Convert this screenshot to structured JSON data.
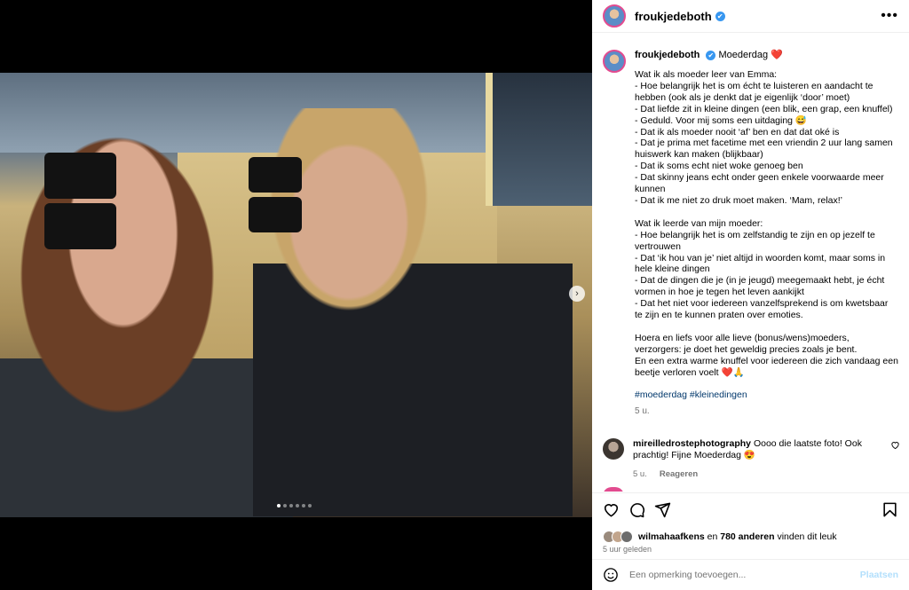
{
  "post": {
    "username": "froukjedeboth",
    "verified_mark": "✔",
    "more_icon": "more-horizontal-icon",
    "caption_title": "Moederdag",
    "caption_heart": "❤️",
    "caption": "Wat ik als moeder leer van Emma:\n- Hoe belangrijk het is om écht te luisteren en aandacht te hebben (ook als je denkt dat je eigenlijk ‘door’ moet)\n- Dat liefde zit in kleine dingen (een blik, een grap, een knuffel)\n- Geduld. Voor mij soms een uitdaging 😅\n- Dat ik als moeder nooit ‘af’ ben en dat dat oké is\n- Dat je prima met facetime met een vriendin 2 uur lang samen huiswerk kan maken (blijkbaar)\n- Dat ik soms echt niet woke genoeg ben\n- Dat skinny jeans echt onder geen enkele voorwaarde meer kunnen\n- Dat ik me niet zo druk moet maken. ‘Mam, relax!’\n\nWat ik leerde van mijn moeder:\n- Hoe belangrijk het is om zelfstandig te zijn en op jezelf te vertrouwen\n- Dat ‘ik hou van je’ niet altijd in woorden komt, maar soms in hele kleine dingen\n- Dat de dingen die je (in je jeugd) meegemaakt hebt, je écht vormen in hoe je tegen het leven aankijkt\n- Dat het niet voor iedereen vanzelfsprekend is om kwetsbaar te zijn en te kunnen praten over emoties.\n\nHoera en liefs voor alle lieve (bonus/wens)moeders, verzorgers: je doet het geweldig precies zoals je bent.\nEn een extra warme knuffel voor iedereen die zich vandaag een beetje verloren voelt ❤️🙏",
    "hashtags": "#moederdag #kleinedingen",
    "caption_time": "5 u."
  },
  "comment": {
    "username": "mireilledrostephotography",
    "text": "Oooo die laatste foto! Ook prachtig! Fijne Moederdag 😍",
    "time": "5 u.",
    "reply_label": "Reageren"
  },
  "actions": {
    "icons": [
      "heart-icon",
      "comment-icon",
      "share-icon",
      "bookmark-icon"
    ]
  },
  "likes": {
    "first_user": "wilmahaafkens",
    "middle": "en",
    "count_text": "780 anderen",
    "suffix": "vinden dit leuk",
    "posted": "5 uur geleden"
  },
  "comment_box": {
    "placeholder": "Een opmerking toevoegen...",
    "post_label": "Plaatsen"
  },
  "carousel": {
    "total_slides": 6,
    "active_slide": 1,
    "next_icon": "›"
  }
}
